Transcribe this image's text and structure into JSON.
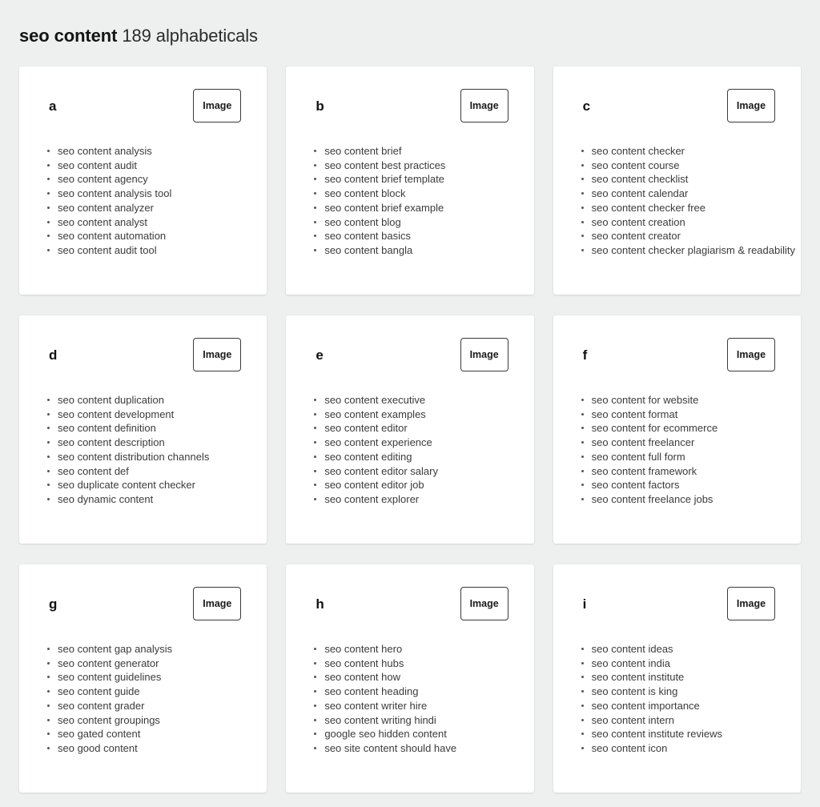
{
  "header": {
    "keyword": "seo content",
    "count_text": "189 alphabeticals"
  },
  "image_placeholder_label": "Image",
  "colors": {
    "page_background": "#eef0ef",
    "card_background": "#ffffff",
    "heading_text": "#141414",
    "list_text": "#3b3b3b",
    "placeholder_border": "#3a3a3a"
  },
  "cards": [
    {
      "letter": "a",
      "image_label": "Image",
      "items": [
        "seo content analysis",
        "seo content audit",
        "seo content agency",
        "seo content analysis tool",
        "seo content analyzer",
        "seo content analyst",
        "seo content automation",
        "seo content audit tool"
      ]
    },
    {
      "letter": "b",
      "image_label": "Image",
      "items": [
        "seo content brief",
        "seo content best practices",
        "seo content brief template",
        "seo content block",
        "seo content brief example",
        "seo content blog",
        "seo content basics",
        "seo content bangla"
      ]
    },
    {
      "letter": "c",
      "image_label": "Image",
      "items": [
        "seo content checker",
        "seo content course",
        "seo content checklist",
        "seo content calendar",
        "seo content checker free",
        "seo content creation",
        "seo content creator",
        "seo content checker plagiarism & readability"
      ]
    },
    {
      "letter": "d",
      "image_label": "Image",
      "items": [
        "seo content duplication",
        "seo content development",
        "seo content definition",
        "seo content description",
        "seo content distribution channels",
        "seo content def",
        "seo duplicate content checker",
        "seo dynamic content"
      ]
    },
    {
      "letter": "e",
      "image_label": "Image",
      "items": [
        "seo content executive",
        "seo content examples",
        "seo content editor",
        "seo content experience",
        "seo content editing",
        "seo content editor salary",
        "seo content editor job",
        "seo content explorer"
      ]
    },
    {
      "letter": "f",
      "image_label": "Image",
      "items": [
        "seo content for website",
        "seo content format",
        "seo content for ecommerce",
        "seo content freelancer",
        "seo content full form",
        "seo content framework",
        "seo content factors",
        "seo content freelance jobs"
      ]
    },
    {
      "letter": "g",
      "image_label": "Image",
      "items": [
        "seo content gap analysis",
        "seo content generator",
        "seo content guidelines",
        "seo content guide",
        "seo content grader",
        "seo content groupings",
        "seo gated content",
        "seo good content"
      ]
    },
    {
      "letter": "h",
      "image_label": "Image",
      "items": [
        "seo content hero",
        "seo content hubs",
        "seo content how",
        "seo content heading",
        "seo content writer hire",
        "seo content writing hindi",
        "google seo hidden content",
        "seo site content should have"
      ]
    },
    {
      "letter": "i",
      "image_label": "Image",
      "items": [
        "seo content ideas",
        "seo content india",
        "seo content institute",
        "seo content is king",
        "seo content importance",
        "seo content intern",
        "seo content institute reviews",
        "seo content icon"
      ]
    }
  ]
}
